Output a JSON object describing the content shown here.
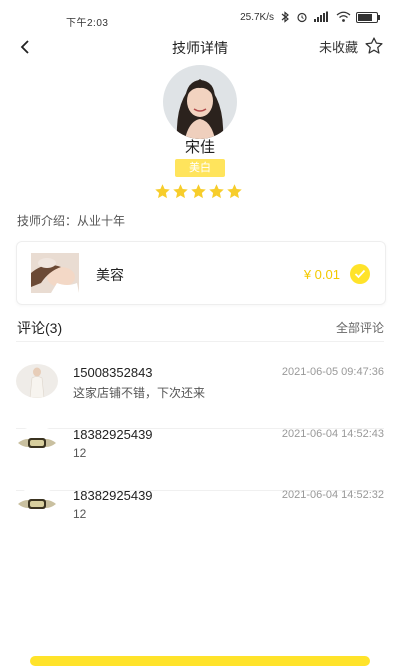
{
  "status_bar": {
    "time": "下午2:03",
    "network_speed": "25.7K/s"
  },
  "nav": {
    "title": "技师详情",
    "favorite_label": "未收藏"
  },
  "technician": {
    "name": "宋佳",
    "tag": "美白",
    "rating": 5,
    "rating_max": 5,
    "intro": "技师介绍：从业十年"
  },
  "service": {
    "name": "美容",
    "price": "¥ 0.01",
    "selected": true
  },
  "reviews": {
    "title": "评论(3)",
    "all_label": "全部评论",
    "items": [
      {
        "user": "15008352843",
        "time": "2021-06-05 09:47:36",
        "text": "这家店铺不错，下次还来"
      },
      {
        "user": "18382925439",
        "time": "2021-06-04 14:52:43",
        "text": "12"
      },
      {
        "user": "18382925439",
        "time": "2021-06-04 14:52:32",
        "text": "12"
      }
    ]
  },
  "colors": {
    "accent": "#ffe32a",
    "price": "#f4c900",
    "tag": "#ffe45c",
    "star": "#f7cd2b"
  }
}
